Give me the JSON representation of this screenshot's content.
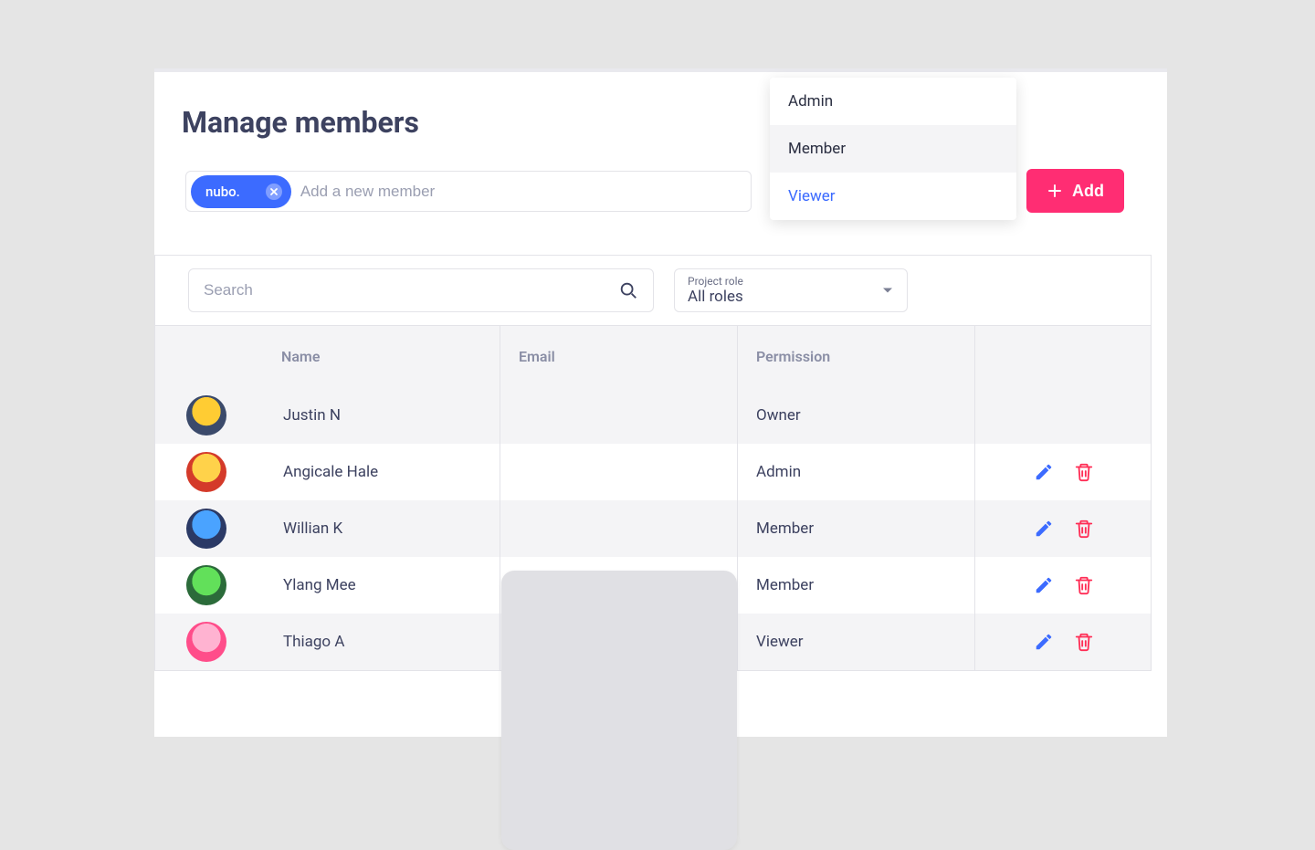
{
  "title": "Manage members",
  "add_row": {
    "chip_text": "nubo.",
    "placeholder": "Add a new member",
    "dropdown": {
      "options": [
        "Admin",
        "Member",
        "Viewer"
      ],
      "hover_index": 1,
      "selected_index": 2
    },
    "add_label": "Add"
  },
  "filters": {
    "search_placeholder": "Search",
    "role_label": "Project role",
    "role_value": "All roles"
  },
  "columns": {
    "name": "Name",
    "email": "Email",
    "permission": "Permission"
  },
  "members": [
    {
      "name": "Justin N",
      "permission": "Owner",
      "editable": false,
      "avatar_colors": [
        "#ffcc33",
        "#3b4a6b"
      ]
    },
    {
      "name": "Angicale Hale",
      "permission": "Admin",
      "editable": true,
      "avatar_colors": [
        "#ffd24a",
        "#d43a2a"
      ]
    },
    {
      "name": "Willian K",
      "permission": "Member",
      "editable": true,
      "avatar_colors": [
        "#4aa3ff",
        "#2b3a66"
      ]
    },
    {
      "name": "Ylang Mee",
      "permission": "Member",
      "editable": true,
      "avatar_colors": [
        "#62e05a",
        "#2b6b3a"
      ]
    },
    {
      "name": "Thiago A",
      "permission": "Viewer",
      "editable": true,
      "avatar_colors": [
        "#ffb3d1",
        "#ff4d8a"
      ]
    }
  ]
}
